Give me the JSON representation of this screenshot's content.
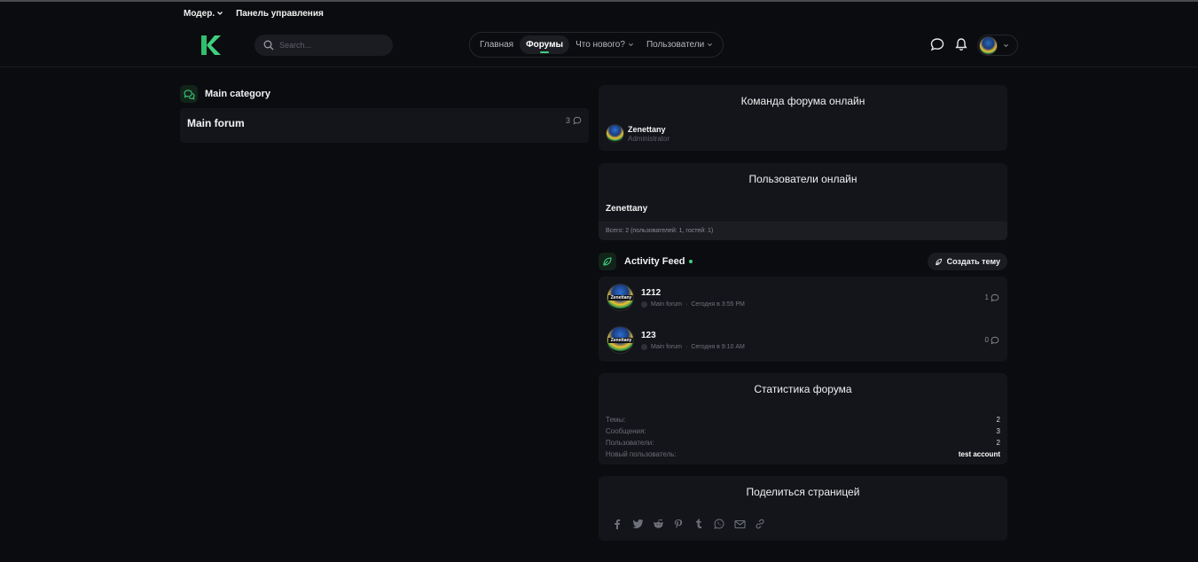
{
  "staffbar": {
    "moder": "Модер.",
    "panel": "Панель управления"
  },
  "header": {
    "search_placeholder": "Search...",
    "nav": [
      {
        "label": "Главная"
      },
      {
        "label": "Форумы"
      },
      {
        "label": "Что нового?"
      },
      {
        "label": "Пользователи"
      }
    ]
  },
  "category": {
    "title": "Main category",
    "forum": {
      "title": "Main forum",
      "count": "3"
    }
  },
  "staff_online": {
    "title": "Команда форума онлайн",
    "user": {
      "name": "Zenettany",
      "role": "Administrator"
    }
  },
  "users_online": {
    "title": "Пользователи онлайн",
    "name": "Zenettany",
    "footer": "Всего: 2 (пользователей: 1, гостей: 1)"
  },
  "activity": {
    "title": "Activity Feed",
    "create_label": "Создать тему",
    "threads": [
      {
        "title": "1212",
        "forum": "Main forum",
        "time": "Сегодня в 3:55 PM",
        "count": "1"
      },
      {
        "title": "123",
        "forum": "Main forum",
        "time": "Сегодня в 9:10 AM",
        "count": "0"
      }
    ]
  },
  "forum_stats": {
    "title": "Статистика форума",
    "rows": [
      {
        "label": "Темы:",
        "value": "2"
      },
      {
        "label": "Сообщения:",
        "value": "3"
      },
      {
        "label": "Пользователи:",
        "value": "2"
      },
      {
        "label": "Новый пользователь:",
        "value": "test account"
      }
    ]
  },
  "share": {
    "title": "Поделиться страницей",
    "icons": [
      "facebook-icon",
      "twitter-icon",
      "reddit-icon",
      "pinterest-icon",
      "tumblr-icon",
      "whatsapp-icon",
      "email-icon",
      "link-icon"
    ]
  },
  "colors": {
    "background": "#0b0c0f",
    "panel": "#14151a",
    "accent": "#3fd07e"
  }
}
